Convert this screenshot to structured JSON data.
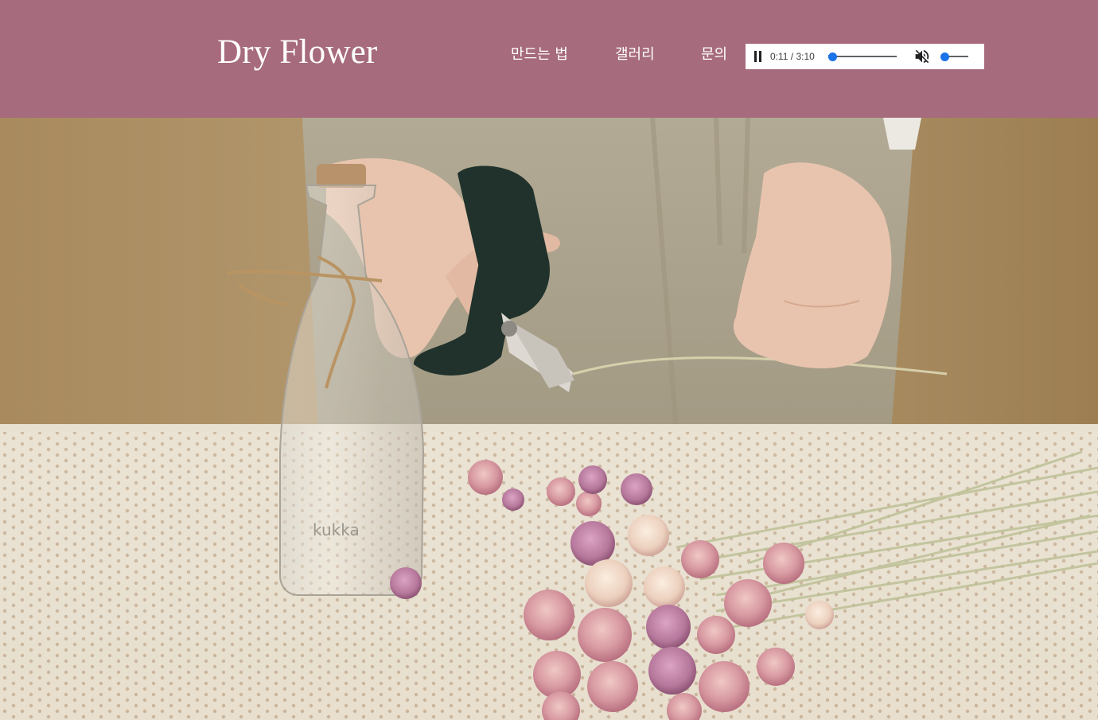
{
  "header": {
    "logo": "Dry Flower",
    "nav": [
      {
        "label": "만드는 법"
      },
      {
        "label": "갤러리"
      },
      {
        "label": "문의"
      }
    ],
    "background_color": "#a66b7c"
  },
  "player": {
    "time": "0:11 / 3:10",
    "state": "playing",
    "progress": 0.058,
    "muted": true,
    "volume": 0.0,
    "accent_color": "#1a73e8",
    "icons": [
      "pause-icon",
      "volume-muted-icon"
    ]
  },
  "video": {
    "bottle_label": "kukka"
  }
}
